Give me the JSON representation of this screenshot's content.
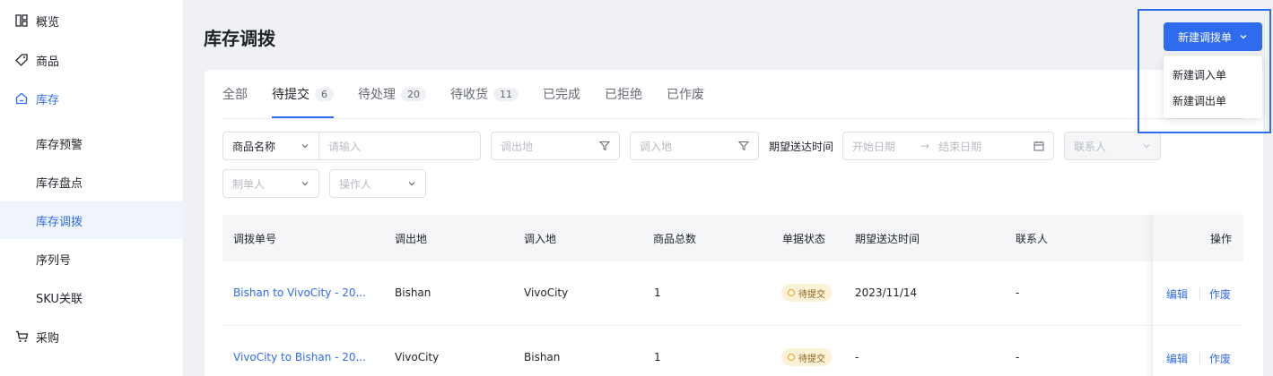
{
  "sidebar": {
    "items": [
      {
        "label": "概览",
        "icon": "dashboard-icon"
      },
      {
        "label": "商品",
        "icon": "tag-icon"
      },
      {
        "label": "库存",
        "icon": "home-icon"
      },
      {
        "label": "库存预警"
      },
      {
        "label": "库存盘点"
      },
      {
        "label": "库存调拨"
      },
      {
        "label": "序列号"
      },
      {
        "label": "SKU关联"
      },
      {
        "label": "采购",
        "icon": "cart-icon"
      }
    ]
  },
  "header": {
    "title": "库存调拨",
    "new_button": "新建调拨单",
    "dropdown": [
      "新建调入单",
      "新建调出单"
    ]
  },
  "tabs": [
    {
      "label": "全部",
      "count": ""
    },
    {
      "label": "待提交",
      "count": "6"
    },
    {
      "label": "待处理",
      "count": "20"
    },
    {
      "label": "待收货",
      "count": "11"
    },
    {
      "label": "已完成",
      "count": ""
    },
    {
      "label": "已拒绝",
      "count": ""
    },
    {
      "label": "已作废",
      "count": ""
    }
  ],
  "filters": {
    "search_field": "商品名称",
    "search_placeholder": "请输入",
    "from_placeholder": "调出地",
    "to_placeholder": "调入地",
    "date_label": "期望送达时间",
    "date_start": "开始日期",
    "date_end": "结束日期",
    "contact_placeholder": "联系人",
    "maker_placeholder": "制单人",
    "operator_placeholder": "操作人"
  },
  "table": {
    "columns": [
      "调拨单号",
      "调出地",
      "调入地",
      "商品总数",
      "单据状态",
      "期望送达时间",
      "联系人",
      "操作"
    ],
    "rows": [
      {
        "id": "Bishan to VivoCity - 20...",
        "from": "Bishan",
        "to": "VivoCity",
        "qty": "1",
        "status": "待提交",
        "date": "2023/11/14",
        "contact": "-",
        "edit": "编辑",
        "void": "作废"
      },
      {
        "id": "VivoCity to Bishan - 20...",
        "from": "VivoCity",
        "to": "Bishan",
        "qty": "1",
        "status": "待提交",
        "date": "-",
        "contact": "-",
        "edit": "编辑",
        "void": "作废"
      }
    ]
  },
  "colors": {
    "accent": "#2f6bef",
    "status_bg": "#fdf1d8",
    "status_border": "#e9a323"
  }
}
